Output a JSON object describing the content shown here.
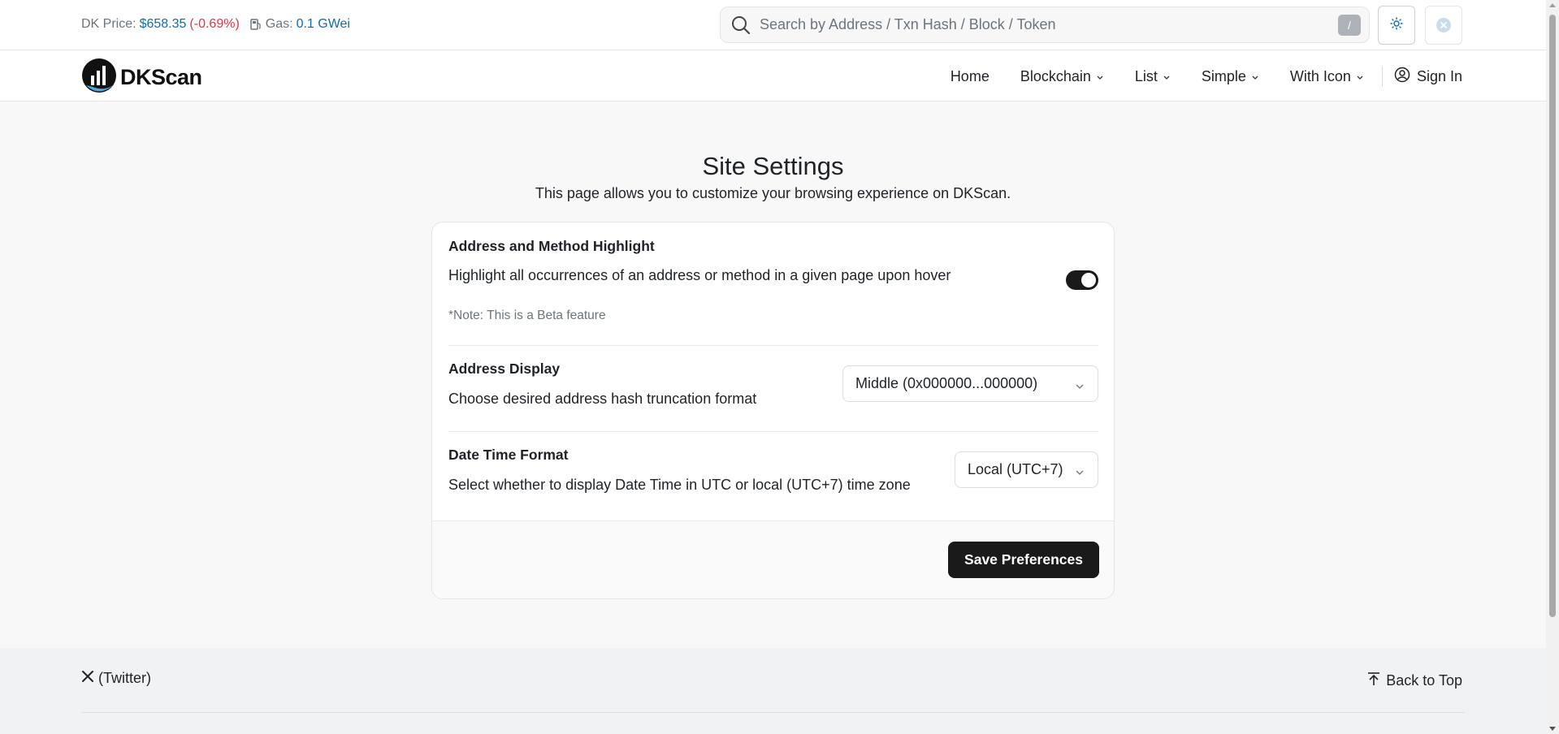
{
  "topbar": {
    "price_label": "DK Price:",
    "price_value": "$658.35",
    "price_change": "(-0.69%)",
    "gas_label": "Gas:",
    "gas_value": "0.1 GWei",
    "search_placeholder": "Search by Address / Txn Hash / Block / Token",
    "search_shortcut": "/"
  },
  "navbar": {
    "logo_text": "DKScan",
    "items": [
      {
        "label": "Home",
        "dropdown": false
      },
      {
        "label": "Blockchain",
        "dropdown": true
      },
      {
        "label": "List",
        "dropdown": true
      },
      {
        "label": "Simple",
        "dropdown": true
      },
      {
        "label": "With Icon",
        "dropdown": true
      }
    ],
    "signin": "Sign In"
  },
  "page": {
    "title": "Site Settings",
    "subtitle": "This page allows you to customize your browsing experience on DKScan."
  },
  "settings": {
    "highlight": {
      "title": "Address and Method Highlight",
      "description": "Highlight all occurrences of an address or method in a given page upon hover",
      "note": "*Note: This is a Beta feature",
      "enabled": true
    },
    "address_display": {
      "title": "Address Display",
      "description": "Choose desired address hash truncation format",
      "selected": "Middle (0x000000...000000)"
    },
    "datetime": {
      "title": "Date Time Format",
      "description": "Select whether to display Date Time in UTC or local (UTC+7) time zone",
      "selected": "Local (UTC+7)"
    },
    "save_label": "Save Preferences"
  },
  "footer": {
    "twitter": "(Twitter)",
    "back_to_top": "Back to Top"
  },
  "colors": {
    "accent_link": "#0d6dae",
    "negative": "#dc3545",
    "button_dark": "#1a1a1a"
  }
}
